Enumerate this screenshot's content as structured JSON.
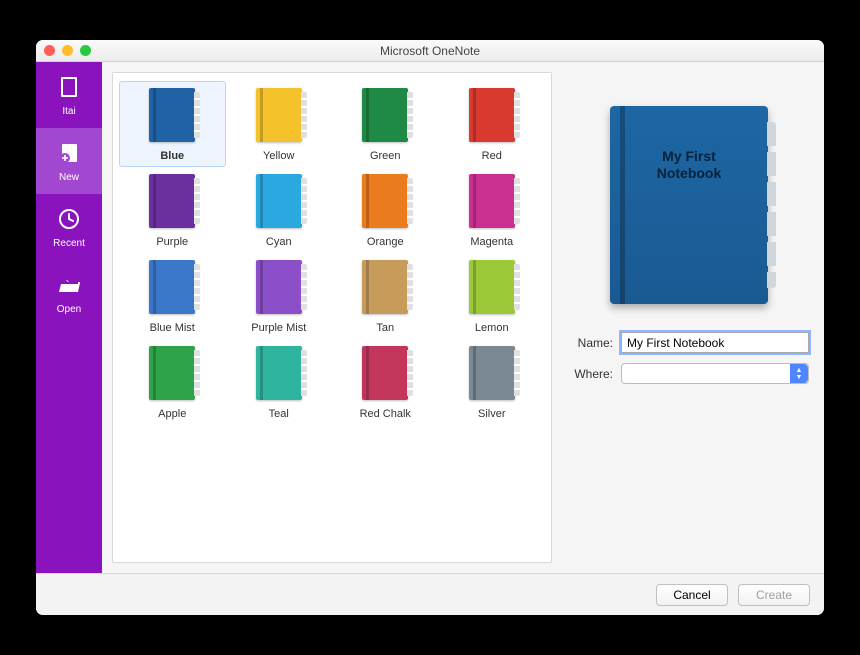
{
  "window": {
    "title": "Microsoft OneNote"
  },
  "sidebar": {
    "items": [
      {
        "label": "Itai"
      },
      {
        "label": "New"
      },
      {
        "label": "Recent"
      },
      {
        "label": "Open"
      }
    ]
  },
  "palette": {
    "swatches": [
      {
        "label": "Blue",
        "color": "#1f62a5",
        "selected": true
      },
      {
        "label": "Yellow",
        "color": "#f4c22b"
      },
      {
        "label": "Green",
        "color": "#1f8a45"
      },
      {
        "label": "Red",
        "color": "#d83a2f"
      },
      {
        "label": "Purple",
        "color": "#6b2fa0"
      },
      {
        "label": "Cyan",
        "color": "#29a9e0"
      },
      {
        "label": "Orange",
        "color": "#ea7b1f"
      },
      {
        "label": "Magenta",
        "color": "#c9308f"
      },
      {
        "label": "Blue Mist",
        "color": "#3a77c8"
      },
      {
        "label": "Purple Mist",
        "color": "#8b4fc9"
      },
      {
        "label": "Tan",
        "color": "#c79b5a"
      },
      {
        "label": "Lemon",
        "color": "#9cc93a"
      },
      {
        "label": "Apple",
        "color": "#2fa34a"
      },
      {
        "label": "Teal",
        "color": "#2fb4a0"
      },
      {
        "label": "Red Chalk",
        "color": "#c4355c"
      },
      {
        "label": "Silver",
        "color": "#7a8994"
      }
    ]
  },
  "preview": {
    "title": "My First Notebook",
    "color": "#1d67a4"
  },
  "form": {
    "name_label": "Name:",
    "name_value": "My First Notebook",
    "where_label": "Where:",
    "where_value": ""
  },
  "footer": {
    "cancel_label": "Cancel",
    "create_label": "Create"
  }
}
